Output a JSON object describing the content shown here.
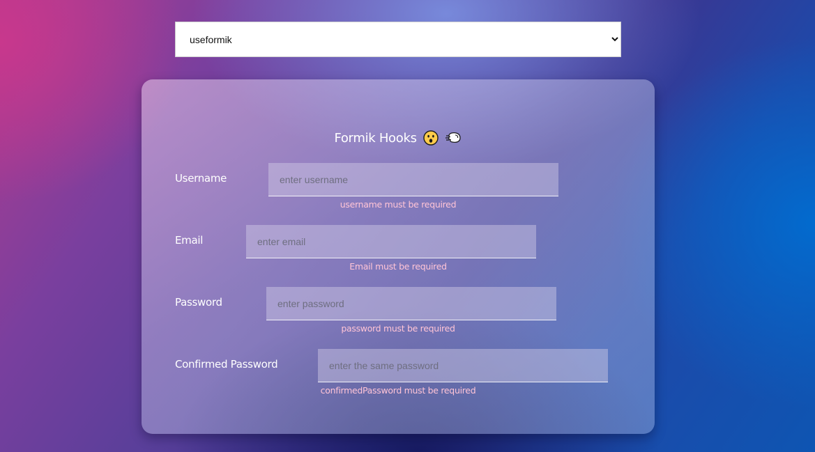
{
  "selector": {
    "selected": "useformik",
    "options": [
      "useformik"
    ]
  },
  "form": {
    "title": "Formik Hooks",
    "title_icons": [
      "astonished-face-emoji",
      "dashing-away-emoji"
    ],
    "fields": [
      {
        "label": "Username",
        "placeholder": "enter username",
        "value": "",
        "error": "username must be required"
      },
      {
        "label": "Email",
        "placeholder": "enter email",
        "value": "",
        "error": "Email must be required"
      },
      {
        "label": "Password",
        "placeholder": "enter password",
        "value": "",
        "error": "password must be required"
      },
      {
        "label": "Confirmed Password",
        "placeholder": "enter the same password",
        "value": "",
        "error": "confirmedPassword must be required"
      }
    ]
  },
  "colors": {
    "error_text": "#ffc4d6",
    "label_text": "#ffffff"
  }
}
